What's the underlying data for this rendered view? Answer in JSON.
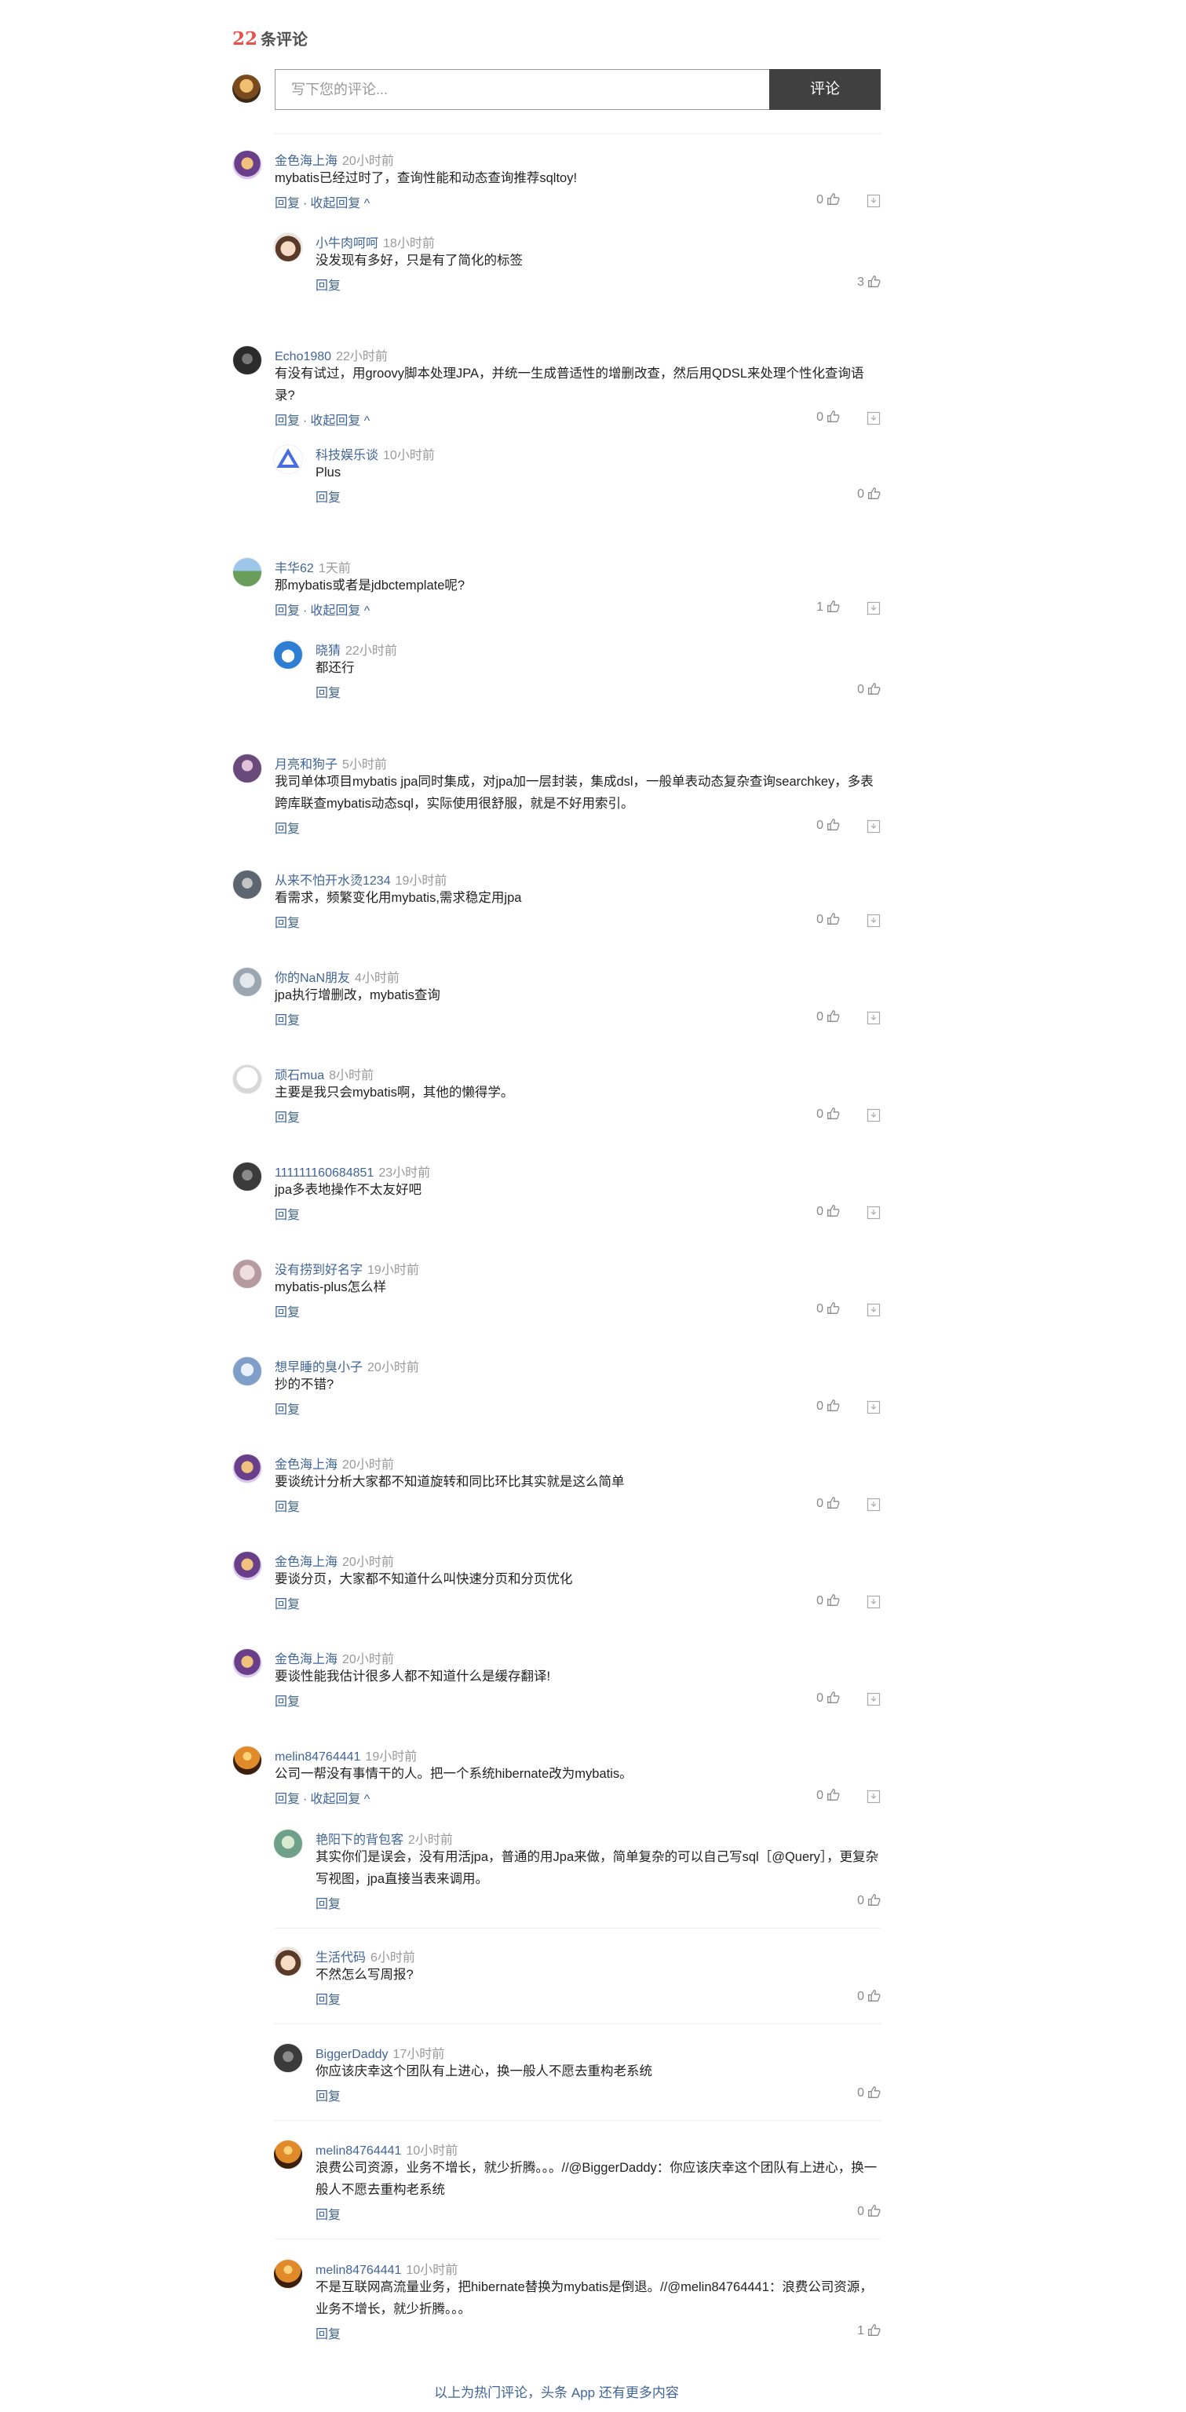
{
  "header": {
    "count_num": "22",
    "count_label": "条评论",
    "input_placeholder": "写下您的评论...",
    "submit_label": "评论"
  },
  "labels": {
    "reply": "回复",
    "collapse": "收起回复",
    "dot": "·",
    "collapse_arrow": "^"
  },
  "comments": [
    {
      "name": "金色海上海",
      "time": "20小时前",
      "text": "mybatis已经过时了，查询性能和动态查询推荐sqltoy!",
      "likes": "0",
      "avatar": "cartoon-avatar",
      "collapse": true,
      "replies": [
        {
          "name": "小牛肉呵呵",
          "time": "18小时前",
          "text": "没发现有多好，只是有了简化的标签",
          "likes": "3",
          "avatar": "anime-avatar"
        }
      ]
    },
    {
      "name": "Echo1980",
      "time": "22小时前",
      "text": "有没有试过，用groovy脚本处理JPA，并统一生成普适性的增删改查，然后用QDSL来处理个性化查询语录?",
      "likes": "0",
      "avatar": "dark-avatar",
      "collapse": true,
      "replies": [
        {
          "name": "科技娱乐谈",
          "time": "10小时前",
          "text": "Plus",
          "likes": "0",
          "avatar": "triangle-logo-avatar"
        }
      ]
    },
    {
      "name": "丰华62",
      "time": "1天前",
      "text": "那mybatis或者是jdbctemplate呢?",
      "likes": "1",
      "avatar": "landscape-avatar",
      "collapse": true,
      "replies": [
        {
          "name": "晓猜",
          "time": "22小时前",
          "text": "都还行",
          "likes": "0",
          "avatar": "doraemon-avatar"
        }
      ]
    },
    {
      "name": "月亮和狗子",
      "time": "5小时前",
      "text": "我司单体项目mybatis jpa同时集成，对jpa加一层封装，集成dsl，一般单表动态复杂查询searchkey，多表跨库联查mybatis动态sql，实际使用很舒服，就是不好用索引。",
      "likes": "0",
      "avatar": "purple-avatar",
      "collapse": false,
      "replies": []
    },
    {
      "name": "从来不怕开水烫1234",
      "time": "19小时前",
      "text": "看需求，频繁变化用mybatis,需求稳定用jpa",
      "likes": "0",
      "avatar": "gray-avatar",
      "collapse": false,
      "replies": []
    },
    {
      "name": "你的NaN朋友",
      "time": "4小时前",
      "text": "jpa执行增删改，mybatis查询",
      "likes": "0",
      "avatar": "sketch-avatar",
      "collapse": false,
      "replies": []
    },
    {
      "name": "顽石mua",
      "time": "8小时前",
      "text": "主要是我只会mybatis啊，其他的懒得学。",
      "likes": "0",
      "avatar": "line-drawing-avatar",
      "collapse": false,
      "replies": []
    },
    {
      "name": "111111160684851",
      "time": "23小时前",
      "text": "jpa多表地操作不太友好吧",
      "likes": "0",
      "avatar": "dark-face-avatar",
      "collapse": false,
      "replies": []
    },
    {
      "name": "没有捞到好名字",
      "time": "19小时前",
      "text": "mybatis-plus怎么样",
      "likes": "0",
      "avatar": "pink-avatar",
      "collapse": false,
      "replies": []
    },
    {
      "name": "想早睡的臭小子",
      "time": "20小时前",
      "text": "抄的不错?",
      "likes": "0",
      "avatar": "blue-avatar",
      "collapse": false,
      "replies": []
    },
    {
      "name": "金色海上海",
      "time": "20小时前",
      "text": "要谈统计分析大家都不知道旋转和同比环比其实就是这么简单",
      "likes": "0",
      "avatar": "cartoon-avatar",
      "collapse": false,
      "replies": []
    },
    {
      "name": "金色海上海",
      "time": "20小时前",
      "text": "要谈分页，大家都不知道什么叫快速分页和分页优化",
      "likes": "0",
      "avatar": "cartoon-avatar",
      "collapse": false,
      "replies": []
    },
    {
      "name": "金色海上海",
      "time": "20小时前",
      "text": "要谈性能我估计很多人都不知道什么是缓存翻译!",
      "likes": "0",
      "avatar": "cartoon-avatar",
      "collapse": false,
      "replies": []
    },
    {
      "name": "melin84764441",
      "time": "19小时前",
      "text": "公司一帮没有事情干的人。把一个系统hibernate改为mybatis。",
      "likes": "0",
      "avatar": "sunset-avatar",
      "collapse": true,
      "replies": [
        {
          "name": "艳阳下的背包客",
          "time": "2小时前",
          "text": "其实你们是误会，没有用活jpa，普通的用Jpa来做，简单复杂的可以自己写sql［@Query］，更复杂写视图，jpa直接当表来调用。",
          "likes": "0",
          "avatar": "green-avatar"
        },
        {
          "name": "生活代码",
          "time": "6小时前",
          "text": "不然怎么写周报?",
          "likes": "0",
          "avatar": "anime-avatar"
        },
        {
          "name": "BiggerDaddy",
          "time": "17小时前",
          "text": "你应该庆幸这个团队有上进心，换一般人不愿去重构老系统",
          "likes": "0",
          "avatar": "dark-face-avatar"
        },
        {
          "name": "melin84764441",
          "time": "10小时前",
          "text": "浪费公司资源，业务不增长，就少折腾。。。//@BiggerDaddy：你应该庆幸这个团队有上进心，换一般人不愿去重构老系统",
          "likes": "0",
          "avatar": "sunset-avatar"
        },
        {
          "name": "melin84764441",
          "time": "10小时前",
          "text": "不是互联网高流量业务，把hibernate替换为mybatis是倒退。//@melin84764441：浪费公司资源，业务不增长，就少折腾。。。",
          "likes": "1",
          "avatar": "sunset-avatar"
        }
      ]
    }
  ],
  "footer": {
    "text": "以上为热门评论，头条 App 还有更多内容"
  },
  "colors": {
    "link": "#406599",
    "time": "#999999",
    "accent": "#e8504c",
    "button_bg": "#404040"
  }
}
